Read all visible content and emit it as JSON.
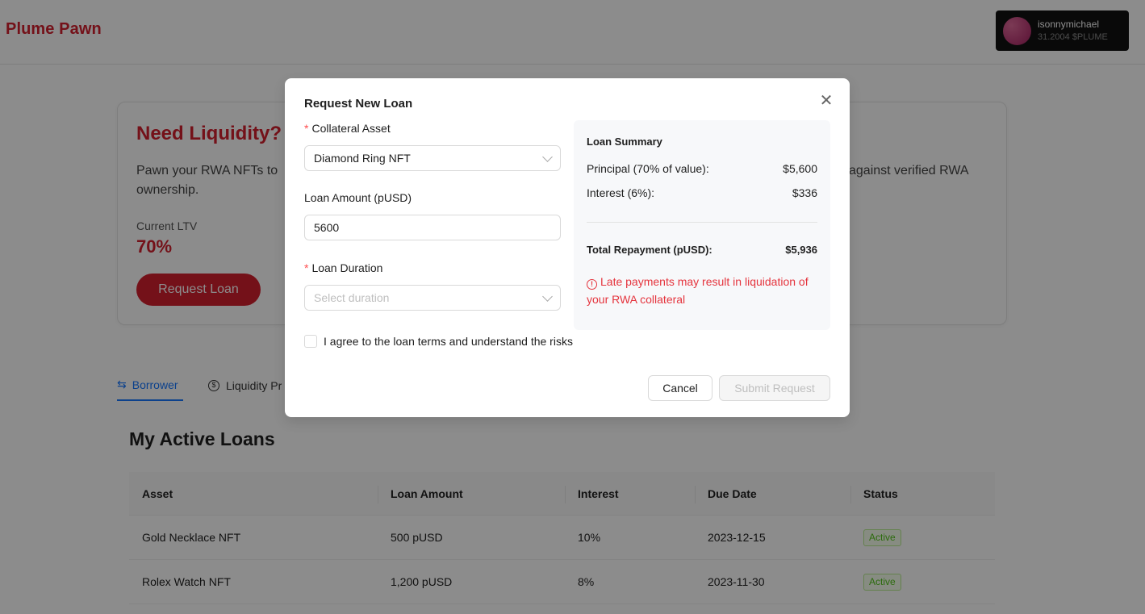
{
  "header": {
    "brand": "Plume Pawn",
    "user": {
      "name": "isonnymichael",
      "balance": "31.2004 $PLUME"
    }
  },
  "hero": {
    "title": "Need Liquidity?",
    "description_left": "Pawn your RWA NFTs to",
    "description_left_2": "ownership.",
    "description_right": "against verified RWA",
    "ltv_label": "Current LTV",
    "ltv_value": "70%",
    "button_label": "Request Loan"
  },
  "tabs": [
    {
      "label": "Borrower",
      "icon": "swap-icon",
      "active": true
    },
    {
      "label": "Liquidity Pr",
      "icon": "dollar-coin-icon",
      "active": false
    }
  ],
  "loans": {
    "title": "My Active Loans",
    "columns": [
      "Asset",
      "Loan Amount",
      "Interest",
      "Due Date",
      "Status"
    ],
    "rows": [
      {
        "asset": "Gold Necklace NFT",
        "amount": "500 pUSD",
        "interest": "10%",
        "due": "2023-12-15",
        "status": "Active"
      },
      {
        "asset": "Rolex Watch NFT",
        "amount": "1,200 pUSD",
        "interest": "8%",
        "due": "2023-11-30",
        "status": "Active"
      }
    ]
  },
  "modal": {
    "title": "Request New Loan",
    "collateral": {
      "label": "Collateral Asset",
      "value": "Diamond Ring NFT"
    },
    "amount": {
      "label": "Loan Amount (pUSD)",
      "value": "5600"
    },
    "duration": {
      "label": "Loan Duration",
      "placeholder": "Select duration"
    },
    "summary": {
      "title": "Loan Summary",
      "principal_label": "Principal (70% of value):",
      "principal_value": "$5,600",
      "interest_label": "Interest (6%):",
      "interest_value": "$336",
      "total_label": "Total Repayment (pUSD):",
      "total_value": "$5,936",
      "warning": "Late payments may result in liquidation of your RWA collateral"
    },
    "agree_label": "I agree to the loan terms and understand the risks",
    "cancel_label": "Cancel",
    "submit_label": "Submit Request"
  },
  "colors": {
    "brand": "#d3202f",
    "accent": "#1677ff",
    "success": "#52c41a",
    "warning": "#e5343d"
  }
}
